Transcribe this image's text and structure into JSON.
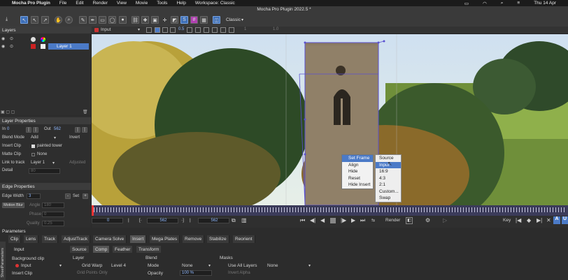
{
  "menubar": {
    "app": "Mocha Pro Plugin",
    "items": [
      "File",
      "Edit",
      "Render",
      "View",
      "Movie",
      "Tools",
      "Help",
      "Workspace: Classic"
    ],
    "clock": "Thu 14 Apr"
  },
  "window_title": "Mocha Pro Plugin 2022.5 *",
  "toolbar": {
    "workspace": "Classic",
    "opacity_value": "0.5"
  },
  "viewer_bar": {
    "layer_name": "Input",
    "num_a": "1",
    "num_b": "1.0"
  },
  "layers_panel": {
    "title": "Layers",
    "layer_name": "Layer 1"
  },
  "layer_props": {
    "title": "Layer Properties",
    "in_label": "In",
    "in_value": "0",
    "out_label": "Out",
    "out_value": "562",
    "blend_mode_label": "Blend Mode",
    "blend_mode_value": "Add",
    "invert_label": "Invert",
    "insert_clip_label": "Insert Clip",
    "insert_clip_value": "painted tower",
    "matte_clip_label": "Matte Clip",
    "matte_clip_value": "None",
    "link_label": "Link to track",
    "link_value": "Layer 1",
    "adjusted_label": "Adjusted",
    "detail_label": "Detail",
    "detail_value": "80"
  },
  "edge_props": {
    "title": "Edge Properties",
    "edge_width_label": "Edge Width",
    "edge_width_value": "3",
    "set_label": "Set",
    "motion_blur_label": "Motion Blur",
    "angle_label": "Angle",
    "angle_value": "180",
    "phase_label": "Phase",
    "phase_value": "0",
    "quality_label": "Quality",
    "quality_value": "0.25"
  },
  "context_menu": {
    "items": [
      "Set Frame",
      "Align",
      "Hide",
      "Reset",
      "Hide Insert"
    ]
  },
  "submenu": {
    "items": [
      "Source",
      "Input",
      "16:9",
      "4:3",
      "2:1",
      "Custom...",
      "Swap"
    ],
    "highlighted": "Input"
  },
  "transport": {
    "frame_start": "0",
    "in_value": "562",
    "out_value": "562",
    "render_label": "Render",
    "key_label": "Key"
  },
  "params": {
    "title": "Parameters",
    "tabs": [
      "Clip",
      "Lens",
      "Track",
      "AdjustTrack",
      "Camera Solve",
      "Insert",
      "Mega Plates",
      "Remove",
      "Stabilize",
      "Reorient"
    ],
    "subtabs": [
      "Input",
      "Source",
      "Comp",
      "Feather",
      "Transform"
    ],
    "background_clip_label": "Background clip",
    "background_clip_value": "Input",
    "insert_clip_label": "Insert Clip",
    "layer_label": "Layer",
    "grid_warp_label": "Grid Warp",
    "level_value": "Level 4",
    "grid_points_label": "Grid Points Only",
    "blend_label": "Blend",
    "mode_label": "Mode",
    "mode_value": "None",
    "opacity_label": "Opacity",
    "opacity_value": "100 %",
    "masks_label": "Masks",
    "use_all_layers_label": "Use All Layers",
    "masks_value": "None",
    "invert_alpha_label": "Invert Alpha",
    "side_label": "Parameters",
    "side_label2": "Sheet"
  },
  "colors": {
    "accent": "#4b7ac7",
    "timeline": "#3b3b5a",
    "panel": "#2e2e2e"
  }
}
